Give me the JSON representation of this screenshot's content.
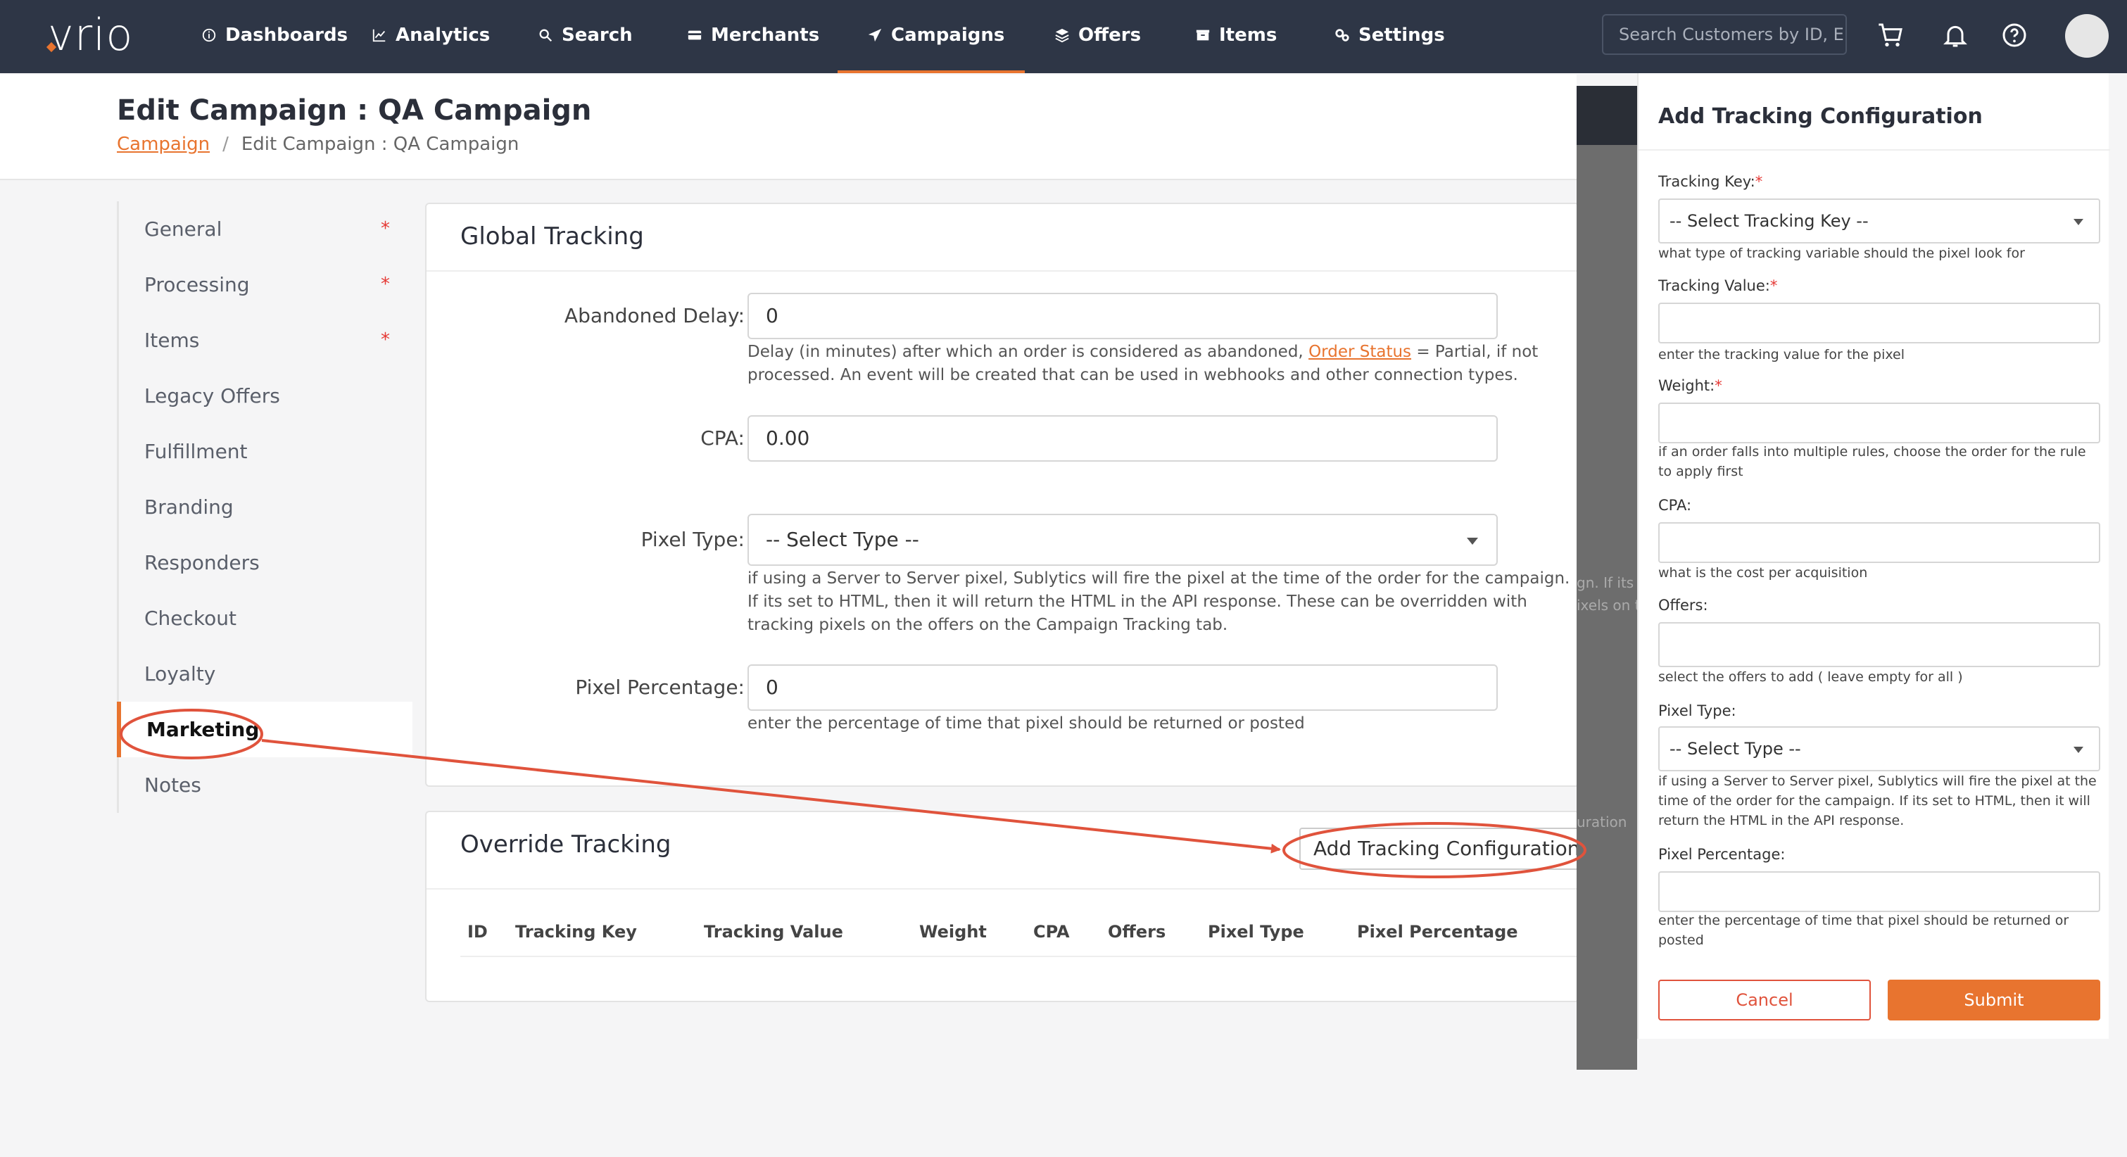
{
  "brand": {
    "logo": "vrio",
    "accent": "#e8742f",
    "nav_bg": "#2e3646"
  },
  "nav": {
    "items": [
      {
        "label": "Dashboards",
        "icon": "info-circle-icon"
      },
      {
        "label": "Analytics",
        "icon": "line-chart-icon"
      },
      {
        "label": "Search",
        "icon": "search-icon"
      },
      {
        "label": "Merchants",
        "icon": "card-icon"
      },
      {
        "label": "Campaigns",
        "icon": "paper-plane-icon",
        "active": true
      },
      {
        "label": "Offers",
        "icon": "layers-icon"
      },
      {
        "label": "Items",
        "icon": "box-icon"
      },
      {
        "label": "Settings",
        "icon": "gears-icon"
      }
    ],
    "search_placeholder": "Search Customers by ID, En"
  },
  "header": {
    "title": "Edit Campaign : QA Campaign",
    "breadcrumb": {
      "link": "Campaign",
      "separator": "/",
      "current": "Edit Campaign : QA Campaign"
    }
  },
  "sidebar": {
    "items": [
      {
        "label": "General",
        "required": "*"
      },
      {
        "label": "Processing",
        "required": "*"
      },
      {
        "label": "Items",
        "required": "*"
      },
      {
        "label": "Legacy Offers",
        "required": ""
      },
      {
        "label": "Fulfillment",
        "required": ""
      },
      {
        "label": "Branding",
        "required": ""
      },
      {
        "label": "Responders",
        "required": ""
      },
      {
        "label": "Checkout",
        "required": ""
      },
      {
        "label": "Loyalty",
        "required": ""
      },
      {
        "label": "Marketing",
        "required": "",
        "active": true
      },
      {
        "label": "Notes",
        "required": ""
      }
    ]
  },
  "global_tracking": {
    "title": "Global Tracking",
    "abandoned_delay": {
      "label": "Abandoned Delay:",
      "value": "0",
      "help_pre": "Delay (in minutes) after which an order is considered as abandoned,",
      "help_link": "Order Status",
      "help_post": "= Partial, if not processed. An event will be created that can be used in webhooks and other connection types."
    },
    "cpa": {
      "label": "CPA:",
      "value": "0.00"
    },
    "pixel_type": {
      "label": "Pixel Type:",
      "value": "-- Select Type --",
      "help": "if using a Server to Server pixel, Sublytics will fire the pixel at the time of the order for the campaign. If its set to HTML, then it will return the HTML in the API response. These can be overridden with tracking pixels on the offers on the Campaign Tracking tab."
    },
    "pixel_percentage": {
      "label": "Pixel Percentage:",
      "value": "0",
      "help": "enter the percentage of time that pixel should be returned or posted"
    }
  },
  "override_tracking": {
    "title": "Override Tracking",
    "add_button": "Add Tracking Configuration",
    "columns": [
      "ID",
      "Tracking Key",
      "Tracking Value",
      "Weight",
      "CPA",
      "Offers",
      "Pixel Type",
      "Pixel Percentage"
    ]
  },
  "background_ghost": {
    "a": "gn. If its s",
    "b": "ixels on th",
    "c": "uration"
  },
  "drawer": {
    "title": "Add Tracking Configuration",
    "tracking_key": {
      "label": "Tracking Key:",
      "required": "*",
      "value": "-- Select Tracking Key --",
      "help": "what type of tracking variable should the pixel look for"
    },
    "tracking_value": {
      "label": "Tracking Value:",
      "required": "*",
      "value": "",
      "help": "enter the tracking value for the pixel"
    },
    "weight": {
      "label": "Weight:",
      "required": "*",
      "value": "",
      "help": "if an order falls into multiple rules, choose the order for the rule to apply first"
    },
    "cpa": {
      "label": "CPA:",
      "value": "",
      "help": "what is the cost per acquisition"
    },
    "offers": {
      "label": "Offers:",
      "value": "",
      "help": "select the offers to add ( leave empty for all )"
    },
    "pixel_type": {
      "label": "Pixel Type:",
      "value": "-- Select Type --",
      "help": "if using a Server to Server pixel, Sublytics will fire the pixel at the time of the order for the campaign. If its set to HTML, then it will return the HTML in the API response."
    },
    "pixel_percentage": {
      "label": "Pixel Percentage:",
      "value": "",
      "help": "enter the percentage of time that pixel should be returned or posted"
    },
    "cancel": "Cancel",
    "submit": "Submit"
  },
  "annotation": {
    "color": "#e0533c"
  }
}
